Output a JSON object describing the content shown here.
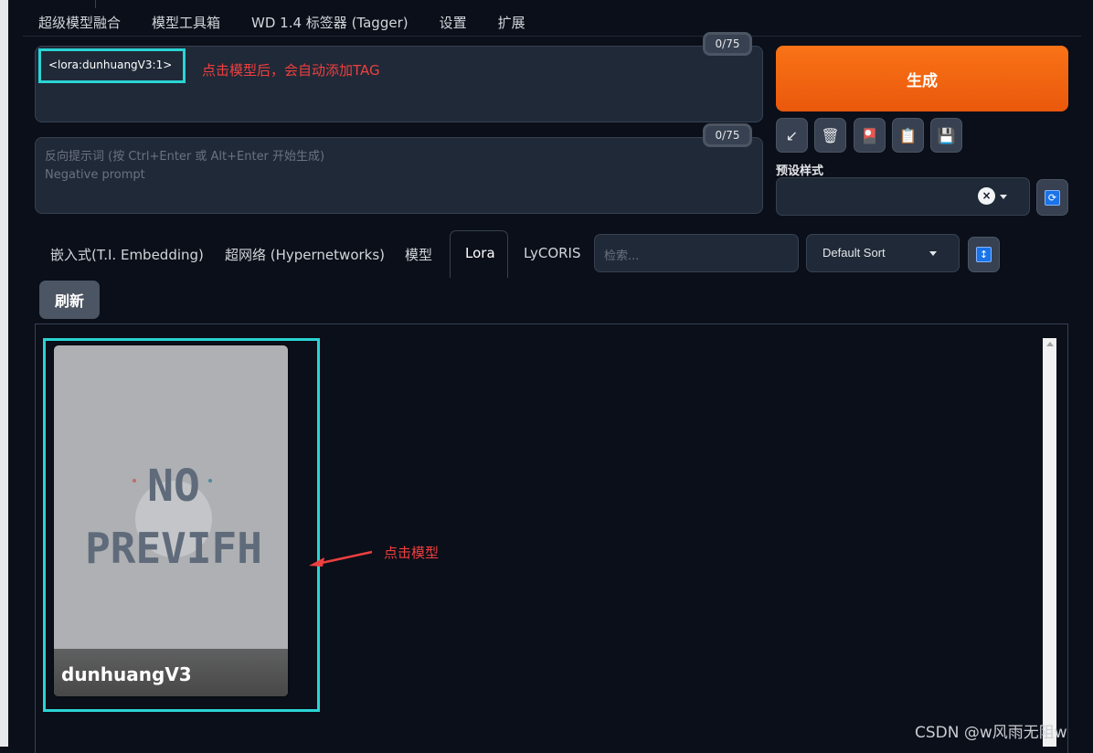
{
  "top_tabs": [
    "超级模型融合",
    "模型工具箱",
    "WD 1.4 标签器 (Tagger)",
    "设置",
    "扩展"
  ],
  "prompt": {
    "value": "<lora:dunhuangV3:1>",
    "counter": "0/75",
    "annotation": "点击模型后，会自动添加TAG"
  },
  "negative_prompt": {
    "placeholder_line1": "反向提示词 (按 Ctrl+Enter 或 Alt+Enter 开始生成)",
    "placeholder_line2": "Negative prompt",
    "counter": "0/75"
  },
  "generate": {
    "label": "生成"
  },
  "toolbar": {
    "icons": [
      "arrow-icon",
      "trash-icon",
      "card-icon",
      "clipboard-icon",
      "save-icon"
    ],
    "glyphs": [
      "↙",
      "🗑",
      "🎴",
      "📋",
      "💾"
    ]
  },
  "preset_styles": {
    "label": "预设样式",
    "clear": "×"
  },
  "network_tabs": [
    "嵌入式(T.I. Embedding)",
    "超网络 (Hypernetworks)",
    "模型",
    "Lora",
    "LyCORIS"
  ],
  "search": {
    "placeholder": "检索..."
  },
  "sort": {
    "value": "Default Sort"
  },
  "refresh": {
    "label": "刷新"
  },
  "card": {
    "name": "dunhuangV3",
    "preview_line1": "NO",
    "preview_line2": "PREVIFH",
    "annotation": "点击模型"
  },
  "icons": {
    "refresh": "⟳",
    "sort_dir": "↕"
  },
  "watermark": "CSDN @w风雨无阻w",
  "colors": {
    "accent_generate": "#f97316",
    "highlight_box": "#2ad4d4",
    "annotation_red": "#ef3f3f",
    "background": "#0b0f19"
  }
}
